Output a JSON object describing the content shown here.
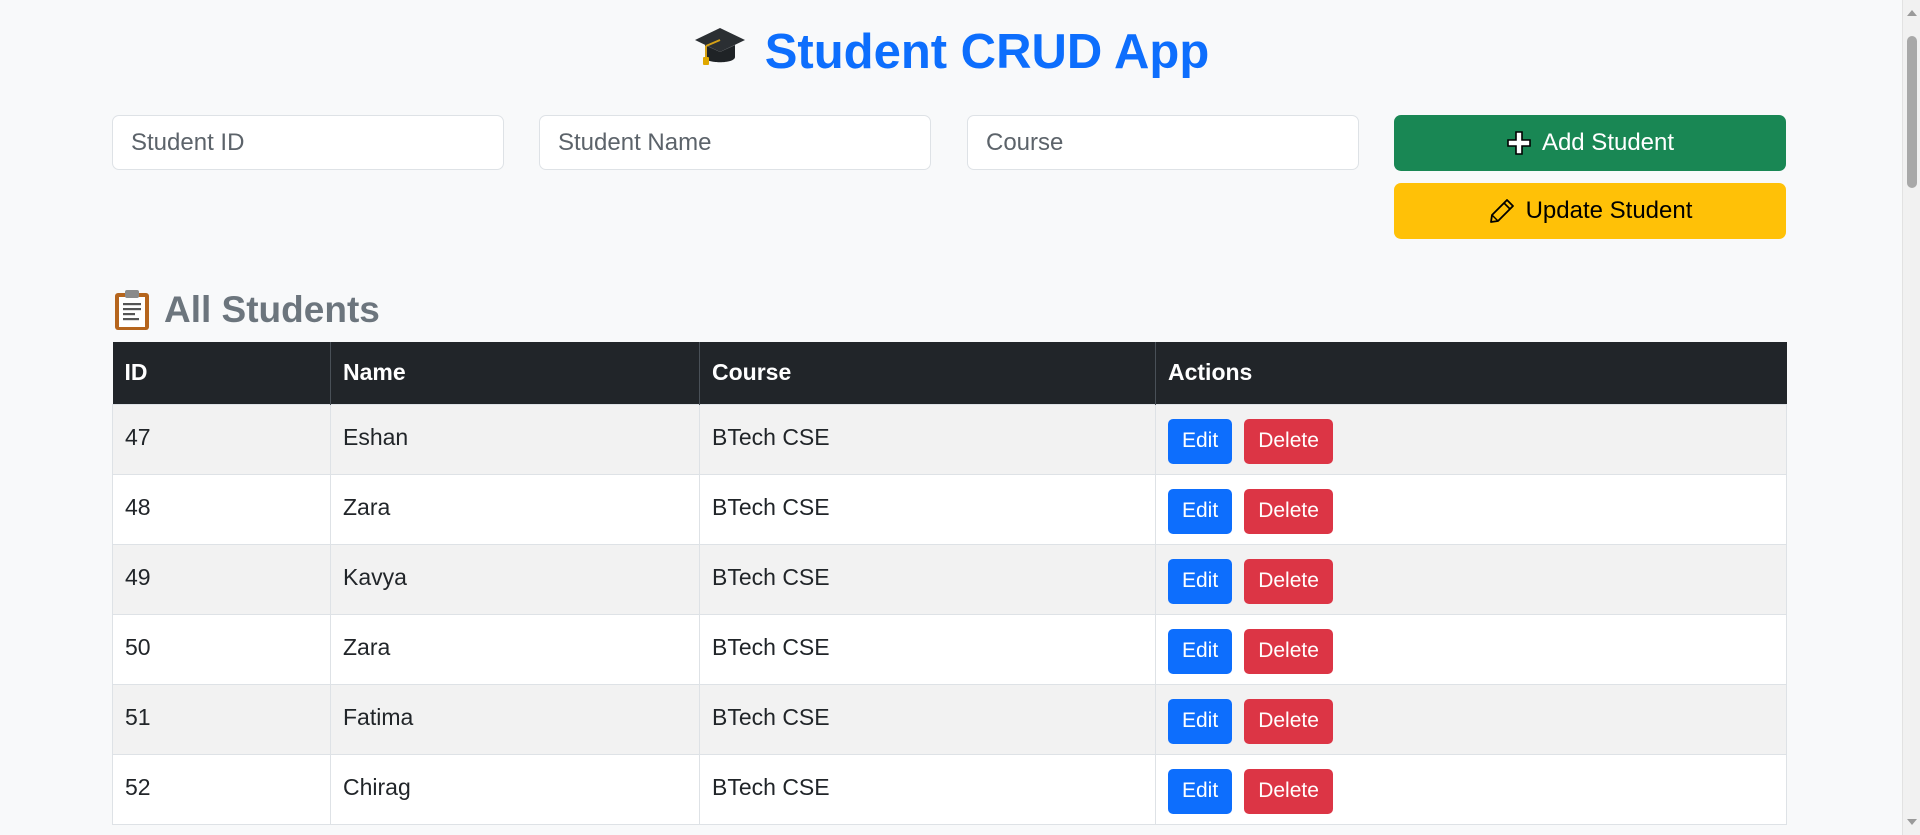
{
  "header": {
    "icon": "graduation-cap-icon",
    "title": "Student CRUD App"
  },
  "form": {
    "id_placeholder": "Student ID",
    "name_placeholder": "Student Name",
    "course_placeholder": "Course",
    "add_label": "Add Student",
    "update_label": "Update Student"
  },
  "list": {
    "icon": "clipboard-icon",
    "title": "All Students",
    "columns": [
      "ID",
      "Name",
      "Course",
      "Actions"
    ],
    "rows": [
      {
        "id": "47",
        "name": "Eshan",
        "course": "BTech CSE"
      },
      {
        "id": "48",
        "name": "Zara",
        "course": "BTech CSE"
      },
      {
        "id": "49",
        "name": "Kavya",
        "course": "BTech CSE"
      },
      {
        "id": "50",
        "name": "Zara",
        "course": "BTech CSE"
      },
      {
        "id": "51",
        "name": "Fatima",
        "course": "BTech CSE"
      },
      {
        "id": "52",
        "name": "Chirag",
        "course": "BTech CSE"
      }
    ],
    "edit_label": "Edit",
    "delete_label": "Delete"
  },
  "colors": {
    "primary": "#0d6efd",
    "success": "#198754",
    "warning": "#ffc107",
    "danger": "#dc3545",
    "header_dark": "#212529",
    "muted": "#6c757d"
  }
}
